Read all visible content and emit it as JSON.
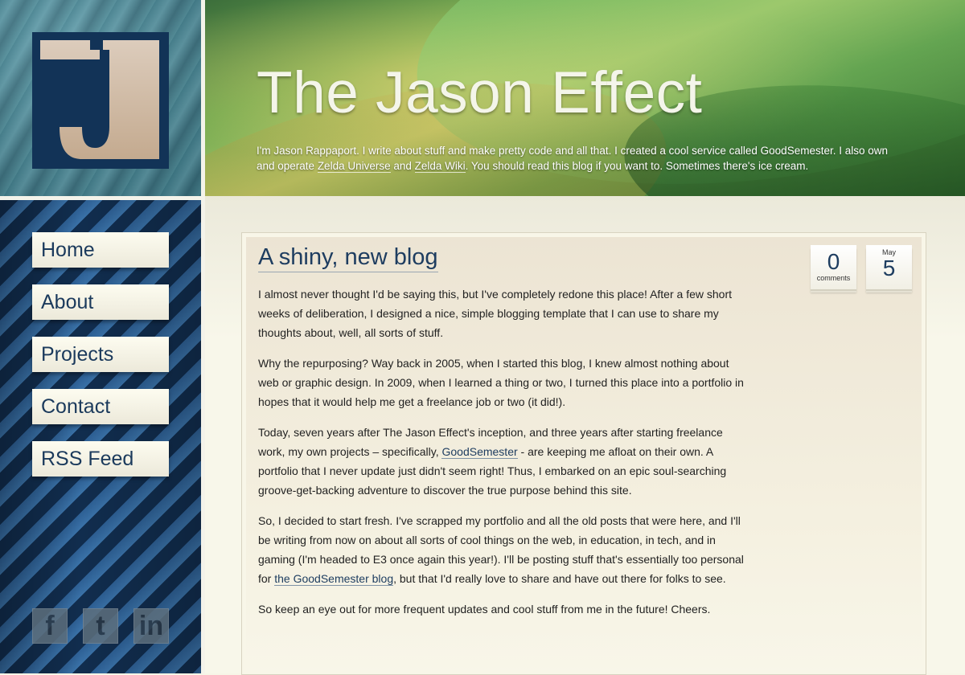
{
  "logo": {
    "letter": "J"
  },
  "nav": {
    "items": [
      {
        "label": "Home"
      },
      {
        "label": "About"
      },
      {
        "label": "Projects"
      },
      {
        "label": "Contact"
      },
      {
        "label": "RSS Feed"
      }
    ]
  },
  "social": {
    "facebook": "f",
    "twitter": "t",
    "linkedin": "in"
  },
  "header": {
    "title": "The Jason Effect",
    "tagline_part1": "I'm Jason Rappaport. I write about stuff and make pretty code and all that. I created a cool service called GoodSemester. I also own and operate ",
    "link_zu": "Zelda Universe",
    "tagline_and": " and ",
    "link_zw": "Zelda Wiki",
    "tagline_part2": ". You should read this blog if you want to. Sometimes there's ice cream."
  },
  "post": {
    "title": "A shiny, new blog",
    "comments_count": "0",
    "comments_label": "comments",
    "date_month": "May",
    "date_day": "5",
    "p1": "I almost never thought I'd be saying this, but I've completely redone this place! After a few short weeks of deliberation, I designed a nice, simple blogging template that I can use to share my thoughts about, well, all sorts of stuff.",
    "p2": "Why the repurposing? Way back in 2005, when I started this blog, I knew almost nothing about web or graphic design. In 2009, when I learned a thing or two, I turned this place into a portfolio in hopes that it would help me get a freelance job or two (it did!).",
    "p3_a": "Today, seven years after The Jason Effect's inception, and three years after starting freelance work, my own projects – specifically, ",
    "p3_link": "GoodSemester",
    "p3_b": " - are keeping me afloat on their own. A portfolio that I never update just didn't seem right! Thus, I embarked on an epic soul-searching groove-get-backing adventure to discover the true purpose behind this site.",
    "p4_a": "So, I decided to start fresh. I've scrapped my portfolio and all the old posts that were here, and I'll be writing from now on about all sorts of cool things on the web, in education, in tech, and in gaming (I'm headed to E3 once again this year!). I'll be posting stuff that's essentially too personal for ",
    "p4_link": "the GoodSemester blog",
    "p4_b": ", but that I'd really love to share and have out there for folks to see.",
    "p5": "So keep an eye out for more frequent updates and cool stuff from me in the future! Cheers."
  }
}
